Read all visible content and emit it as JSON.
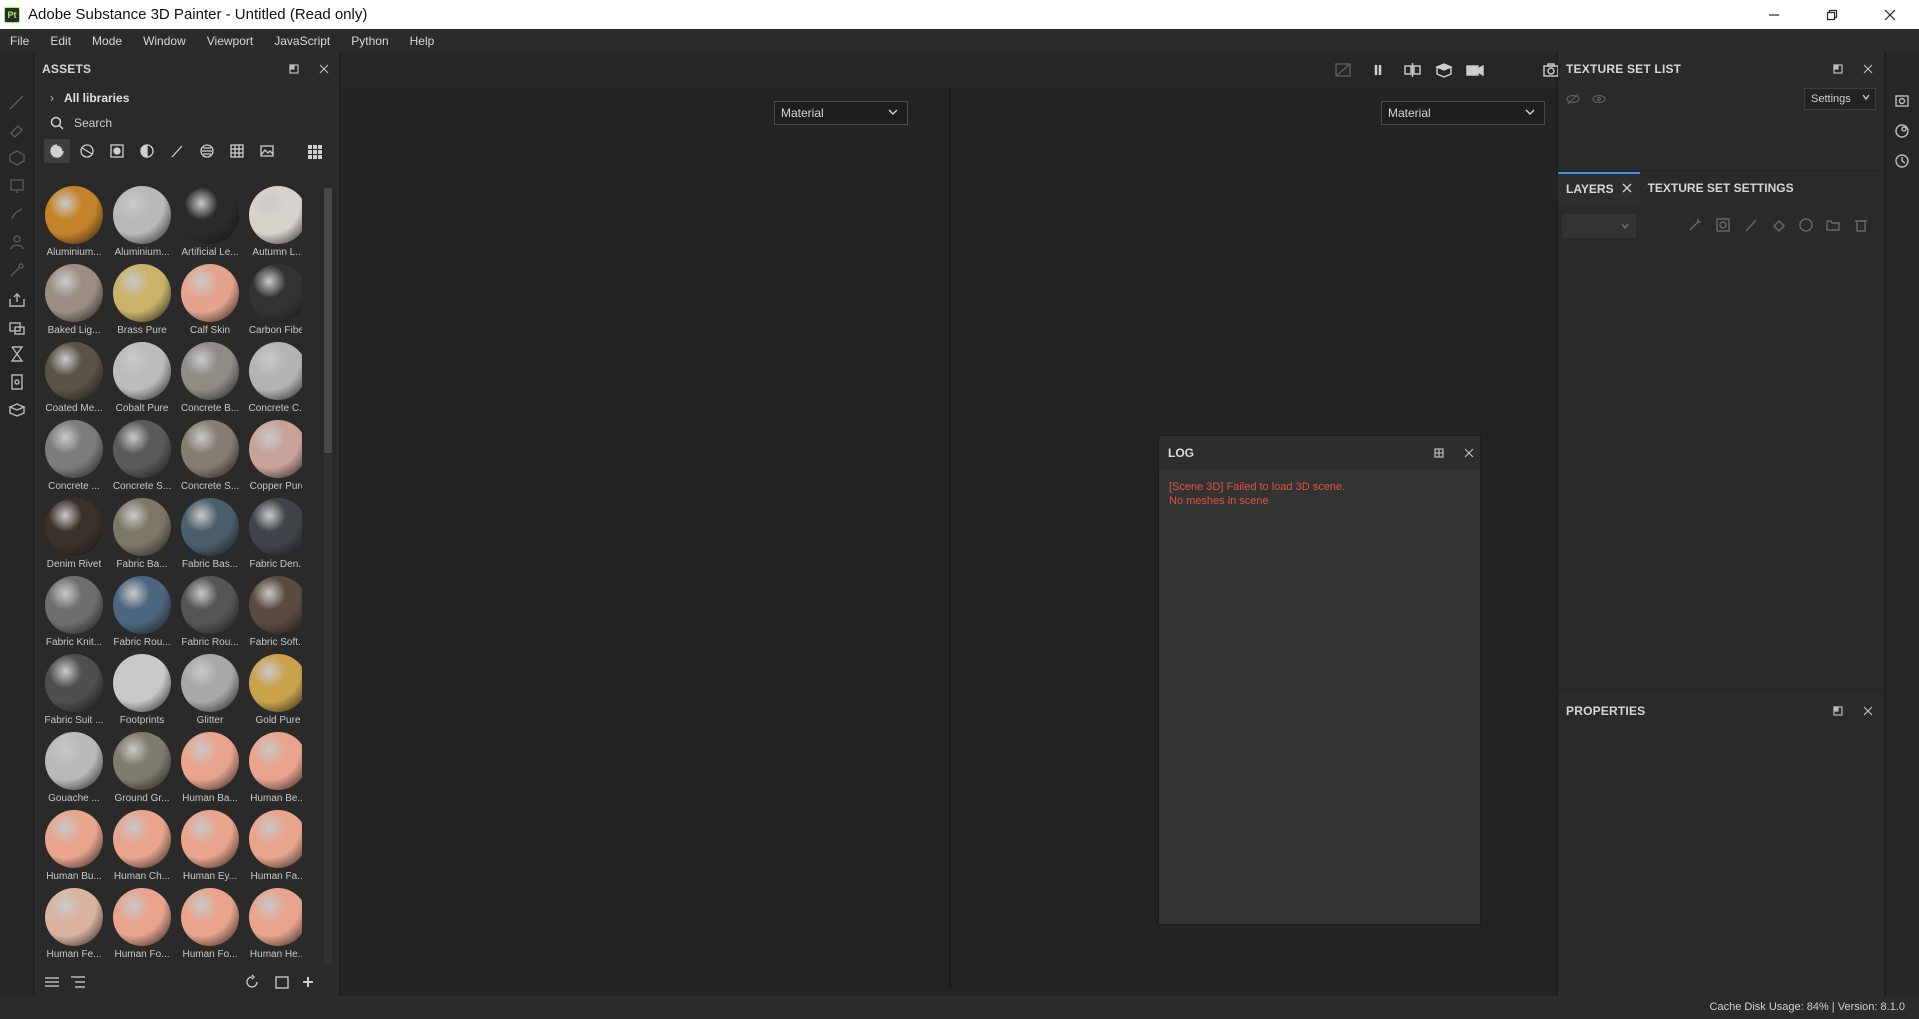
{
  "window": {
    "logo": "Pt",
    "title": "Adobe Substance 3D Painter - Untitled (Read only)"
  },
  "menu": [
    "File",
    "Edit",
    "Mode",
    "Window",
    "Viewport",
    "JavaScript",
    "Python",
    "Help"
  ],
  "assets": {
    "title": "ASSETS",
    "library": "All libraries",
    "search_placeholder": "Search",
    "filters": [
      "material-filter-icon",
      "smart-material-filter-icon",
      "texture-filter-icon",
      "environment-filter-icon",
      "brush-filter-icon",
      "alpha-filter-icon",
      "grid-filter-icon",
      "image-filter-icon"
    ],
    "items": [
      {
        "label": "Aluminium...",
        "color": "#c4832a"
      },
      {
        "label": "Aluminium...",
        "color": "#b9b9b9"
      },
      {
        "label": "Artificial Le...",
        "color": "#2a2a2a"
      },
      {
        "label": "Autumn L...",
        "color": "#d8d2cc"
      },
      {
        "label": "Baked Lig...",
        "color": "#9a8e83"
      },
      {
        "label": "Brass Pure",
        "color": "#c9b26a"
      },
      {
        "label": "Calf Skin",
        "color": "#e5a48e"
      },
      {
        "label": "Carbon Fiber",
        "color": "#333333"
      },
      {
        "label": "Coated Me...",
        "color": "#5a5246"
      },
      {
        "label": "Cobalt Pure",
        "color": "#bcbcbc"
      },
      {
        "label": "Concrete B...",
        "color": "#8f8c86"
      },
      {
        "label": "Concrete C...",
        "color": "#b4b4b4"
      },
      {
        "label": "Concrete ...",
        "color": "#7c7c7c"
      },
      {
        "label": "Concrete S...",
        "color": "#5a5a5a"
      },
      {
        "label": "Concrete S...",
        "color": "#857d72"
      },
      {
        "label": "Copper Pure",
        "color": "#c7a39a"
      },
      {
        "label": "Denim Rivet",
        "color": "#3b3128"
      },
      {
        "label": "Fabric Ba...",
        "color": "#7c7665"
      },
      {
        "label": "Fabric Bas...",
        "color": "#4a5e6c"
      },
      {
        "label": "Fabric Den...",
        "color": "#3e4449"
      },
      {
        "label": "Fabric Knit...",
        "color": "#6e6e6e"
      },
      {
        "label": "Fabric Rou...",
        "color": "#4c6680"
      },
      {
        "label": "Fabric Rou...",
        "color": "#555555"
      },
      {
        "label": "Fabric Soft...",
        "color": "#5a4a40"
      },
      {
        "label": "Fabric Suit ...",
        "color": "#4f4f4f"
      },
      {
        "label": "Footprints",
        "color": "#c9c9c9"
      },
      {
        "label": "Glitter",
        "color": "#a8a8a8"
      },
      {
        "label": "Gold Pure",
        "color": "#c9a24c"
      },
      {
        "label": "Gouache ...",
        "color": "#b9b9b9"
      },
      {
        "label": "Ground Gr...",
        "color": "#7e7a6e"
      },
      {
        "label": "Human Ba...",
        "color": "#e8a48c"
      },
      {
        "label": "Human Be...",
        "color": "#e8a48c"
      },
      {
        "label": "Human Bu...",
        "color": "#e8a48c"
      },
      {
        "label": "Human Ch...",
        "color": "#e8a48c"
      },
      {
        "label": "Human Ey...",
        "color": "#e8a48c"
      },
      {
        "label": "Human Fa...",
        "color": "#e8a48c"
      },
      {
        "label": "Human Fe...",
        "color": "#d9b3a0"
      },
      {
        "label": "Human Fo...",
        "color": "#e8a48c"
      },
      {
        "label": "Human Fo...",
        "color": "#e8a48c"
      },
      {
        "label": "Human He...",
        "color": "#e8a48c"
      }
    ]
  },
  "viewport": {
    "left_mode": "Material",
    "right_mode": "Material"
  },
  "log": {
    "title": "LOG",
    "lines": [
      "[Scene 3D] Failed to load 3D scene.",
      "No meshes in scene"
    ]
  },
  "texture_set_list": {
    "title": "TEXTURE SET LIST",
    "settings_label": "Settings"
  },
  "layers": {
    "tab_layers": "LAYERS",
    "tab_texture_set_settings": "TEXTURE SET SETTINGS"
  },
  "properties": {
    "title": "PROPERTIES"
  },
  "status": {
    "text": "Cache Disk Usage:   84% | Version: 8.1.0"
  },
  "colors": {
    "accent": "#3b8eea",
    "error": "#e0523f",
    "logo": "#9ff46c"
  }
}
